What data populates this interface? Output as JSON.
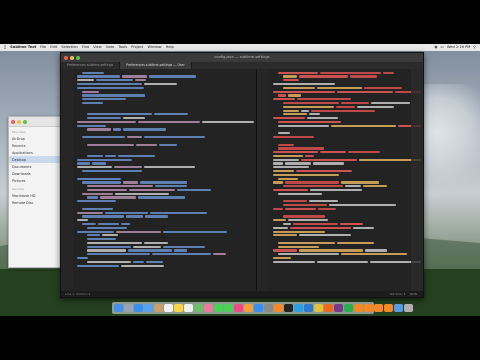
{
  "menubar": {
    "app_menu": "Sublime Text",
    "items": [
      "File",
      "Edit",
      "Selection",
      "Find",
      "View",
      "Goto",
      "Tools",
      "Project",
      "Window",
      "Help"
    ],
    "clock": "Wed 2:16 PM"
  },
  "finder": {
    "favorites_header": "Favorites",
    "items": [
      "AirDrop",
      "Recents",
      "Applications",
      "Desktop",
      "Documents",
      "Downloads",
      "Pictures"
    ],
    "devices_header": "Devices",
    "devices": [
      "Macintosh HD",
      "Remote Disc"
    ],
    "selected_index": 3
  },
  "editor": {
    "window_title": "config.json — sublime-settings",
    "tabs": [
      {
        "label": "Preferences.sublime-settings",
        "active": false
      },
      {
        "label": "Preferences.sublime-settings — User",
        "active": true
      }
    ],
    "status": {
      "left": "Line 1, Column 1",
      "right_items": [
        "Tab Size: 4",
        "JSON"
      ]
    }
  },
  "colors": {
    "comment": "#6a8fc9",
    "key": "#e85a5a",
    "string": "#e0b060",
    "number": "#b48ead",
    "plain": "#c8c8c8",
    "bracket": "#d95050"
  },
  "dock": {
    "icons": [
      "finder-icon",
      "launchpad-icon",
      "safari-icon",
      "mail-icon",
      "contacts-icon",
      "calendar-icon",
      "notes-icon",
      "reminders-icon",
      "maps-icon",
      "photos-icon",
      "messages-icon",
      "facetime-icon",
      "itunes-icon",
      "ibooks-icon",
      "appstore-icon",
      "preferences-icon",
      "sublime-icon",
      "terminal-icon",
      "skype-icon",
      "vscode-icon",
      "chrome-icon",
      "firefox-icon",
      "slack-icon",
      "spotify-icon",
      "sublime-icon-2",
      "sublime-icon-3",
      "sublime-icon-4",
      "sublime-icon-5",
      "folder-icon",
      "trash-icon"
    ]
  }
}
